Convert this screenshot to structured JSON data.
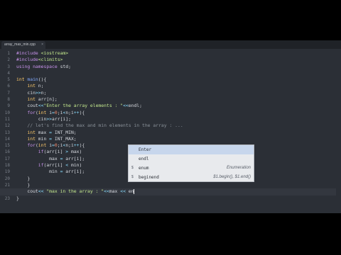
{
  "tab": {
    "title": "array_max_min.cpp",
    "close": "×"
  },
  "lines": [
    {
      "n": "1",
      "segs": [
        {
          "c": "pp",
          "t": "#include "
        },
        {
          "c": "str",
          "t": "<iostream>"
        }
      ]
    },
    {
      "n": "2",
      "segs": [
        {
          "c": "pp",
          "t": "#include"
        },
        {
          "c": "str",
          "t": "<climits>"
        }
      ]
    },
    {
      "n": "3",
      "segs": [
        {
          "c": "kw",
          "t": "using namespace "
        },
        {
          "c": "",
          "t": "std;"
        }
      ]
    },
    {
      "n": "4",
      "segs": []
    },
    {
      "n": "5",
      "segs": [
        {
          "c": "ty",
          "t": "int "
        },
        {
          "c": "fn",
          "t": "main"
        },
        {
          "c": "",
          "t": "(){"
        }
      ]
    },
    {
      "n": "6",
      "segs": [
        {
          "c": "ty",
          "t": "    int "
        },
        {
          "c": "",
          "t": "n;"
        }
      ]
    },
    {
      "n": "7",
      "segs": [
        {
          "c": "",
          "t": "    cin"
        },
        {
          "c": "op",
          "t": ">>"
        },
        {
          "c": "",
          "t": "n;"
        }
      ]
    },
    {
      "n": "8",
      "segs": [
        {
          "c": "ty",
          "t": "    int "
        },
        {
          "c": "",
          "t": "arr[n];"
        }
      ]
    },
    {
      "n": "9",
      "segs": [
        {
          "c": "",
          "t": "    cout"
        },
        {
          "c": "op",
          "t": "<<"
        },
        {
          "c": "str",
          "t": "\"Enter the array elements : \""
        },
        {
          "c": "op",
          "t": "<<"
        },
        {
          "c": "",
          "t": "endl;"
        }
      ]
    },
    {
      "n": "10",
      "segs": [
        {
          "c": "kw",
          "t": "    for"
        },
        {
          "c": "",
          "t": "("
        },
        {
          "c": "ty",
          "t": "int "
        },
        {
          "c": "",
          "t": "i"
        },
        {
          "c": "op",
          "t": "="
        },
        {
          "c": "num",
          "t": "0"
        },
        {
          "c": "",
          "t": ";i"
        },
        {
          "c": "op",
          "t": "<"
        },
        {
          "c": "",
          "t": "n;i"
        },
        {
          "c": "op",
          "t": "++"
        },
        {
          "c": "",
          "t": "){"
        }
      ]
    },
    {
      "n": "11",
      "segs": [
        {
          "c": "",
          "t": "        cin"
        },
        {
          "c": "op",
          "t": ">>"
        },
        {
          "c": "",
          "t": "arr[i];"
        }
      ]
    },
    {
      "n": "12",
      "segs": [
        {
          "c": "cm",
          "t": "    // let's find the max and min elements in the array : ..."
        }
      ]
    },
    {
      "n": "13",
      "segs": [
        {
          "c": "ty",
          "t": "    int "
        },
        {
          "c": "",
          "t": "max "
        },
        {
          "c": "op",
          "t": "="
        },
        {
          "c": "",
          "t": " INT_MIN;"
        }
      ]
    },
    {
      "n": "14",
      "segs": [
        {
          "c": "ty",
          "t": "    int "
        },
        {
          "c": "",
          "t": "min "
        },
        {
          "c": "op",
          "t": "="
        },
        {
          "c": "",
          "t": " INT_MAX;"
        }
      ]
    },
    {
      "n": "15",
      "segs": [
        {
          "c": "kw",
          "t": "    for"
        },
        {
          "c": "",
          "t": "("
        },
        {
          "c": "ty",
          "t": "int "
        },
        {
          "c": "",
          "t": "i"
        },
        {
          "c": "op",
          "t": "="
        },
        {
          "c": "num",
          "t": "0"
        },
        {
          "c": "",
          "t": ";i"
        },
        {
          "c": "op",
          "t": "<"
        },
        {
          "c": "",
          "t": "n;i"
        },
        {
          "c": "op",
          "t": "++"
        },
        {
          "c": "",
          "t": "){"
        }
      ]
    },
    {
      "n": "16",
      "segs": [
        {
          "c": "kw",
          "t": "        if"
        },
        {
          "c": "",
          "t": "(arr[i] "
        },
        {
          "c": "op",
          "t": ">"
        },
        {
          "c": "",
          "t": " max)"
        }
      ]
    },
    {
      "n": "17",
      "segs": [
        {
          "c": "",
          "t": "            max "
        },
        {
          "c": "op",
          "t": "="
        },
        {
          "c": "",
          "t": " arr[i];"
        }
      ]
    },
    {
      "n": "18",
      "segs": [
        {
          "c": "kw",
          "t": "        if"
        },
        {
          "c": "",
          "t": "(arr[i] "
        },
        {
          "c": "op",
          "t": "<"
        },
        {
          "c": "",
          "t": " min)"
        }
      ]
    },
    {
      "n": "19",
      "segs": [
        {
          "c": "",
          "t": "            min "
        },
        {
          "c": "op",
          "t": "="
        },
        {
          "c": "",
          "t": " arr[i];"
        }
      ]
    },
    {
      "n": "20",
      "segs": [
        {
          "c": "",
          "t": "    }"
        }
      ]
    },
    {
      "n": "21",
      "segs": [
        {
          "c": "",
          "t": "    }"
        }
      ]
    },
    {
      "n": "22",
      "active": true,
      "segs": [
        {
          "c": "",
          "t": "    cout"
        },
        {
          "c": "op",
          "t": "<< "
        },
        {
          "c": "str",
          "t": "\"max in the array : \""
        },
        {
          "c": "op",
          "t": "<<"
        },
        {
          "c": "",
          "t": "max "
        },
        {
          "c": "op",
          "t": "<<"
        },
        {
          "c": "",
          "t": " en"
        }
      ]
    },
    {
      "n": "23",
      "segs": [
        {
          "c": "",
          "t": "}"
        }
      ]
    }
  ],
  "autocomplete": {
    "items": [
      {
        "kind": "",
        "label": "Enter",
        "detail": "",
        "selected": true
      },
      {
        "kind": "",
        "label": "endl",
        "detail": ""
      },
      {
        "kind": "$",
        "label": "enum",
        "detail": "Enumeration"
      },
      {
        "kind": "$",
        "label": "beginend",
        "detail": "$1.begin(), $1.end()"
      }
    ]
  },
  "colors": {
    "editor_bg": "#2b2f36",
    "popup_bg": "#e8eaed",
    "selection": "#c7d6ec"
  }
}
